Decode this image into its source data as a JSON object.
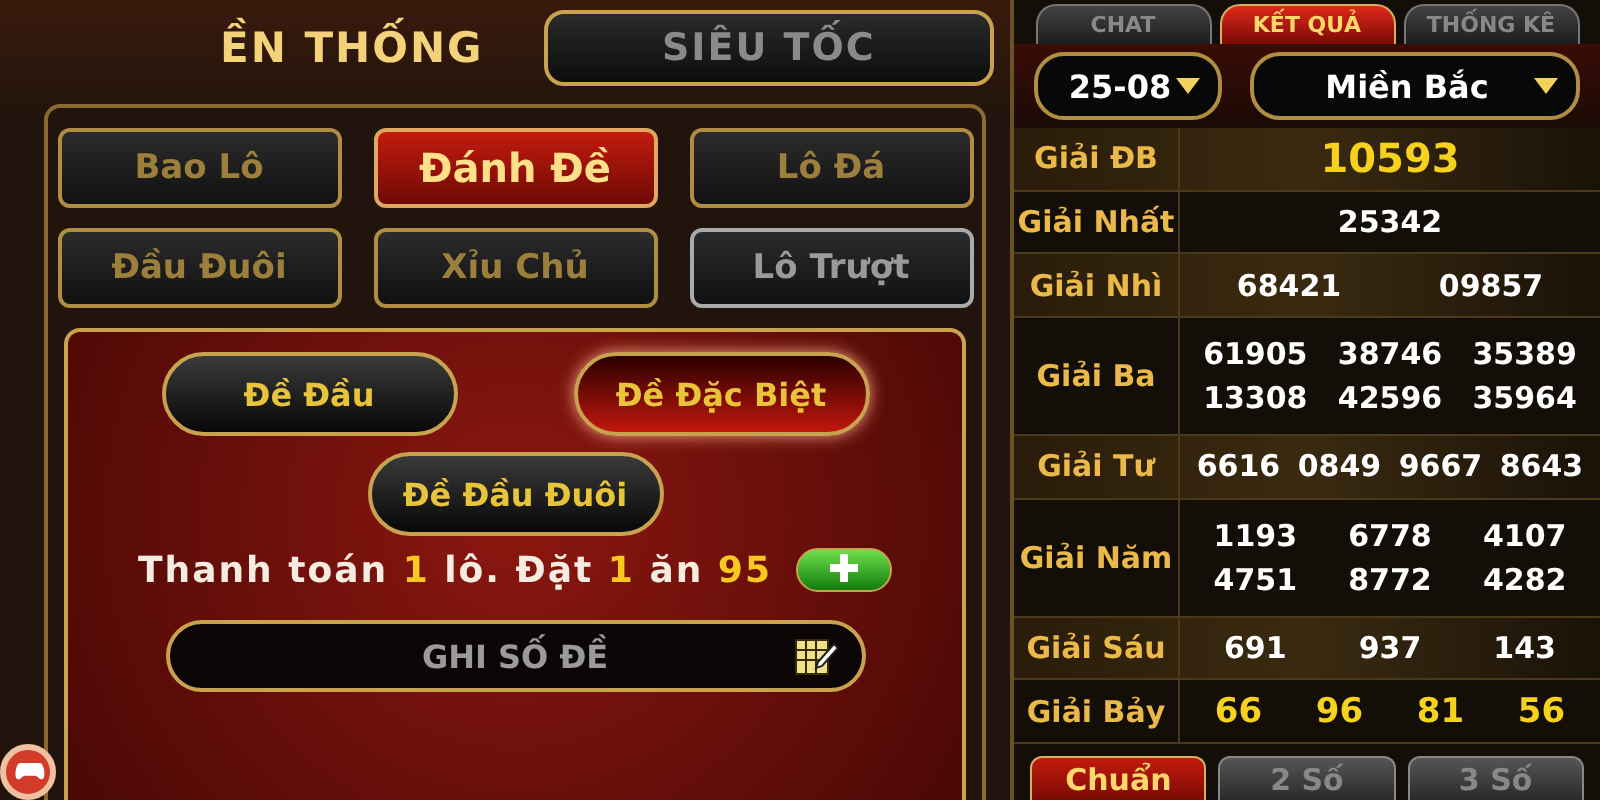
{
  "mode_tabs": [
    {
      "label": "ỀN THỐNG",
      "selected": true
    },
    {
      "label": "SIÊU TỐC",
      "selected": false
    }
  ],
  "bet_types": [
    {
      "label": "Bao Lô",
      "selected": false,
      "disabled": false
    },
    {
      "label": "Đánh Đề",
      "selected": true,
      "disabled": false
    },
    {
      "label": "Lô Đá",
      "selected": false,
      "disabled": false
    },
    {
      "label": "Đầu Đuôi",
      "selected": false,
      "disabled": false
    },
    {
      "label": "Xỉu Chủ",
      "selected": false,
      "disabled": false
    },
    {
      "label": "Lô Trượt",
      "selected": false,
      "disabled": true
    }
  ],
  "sub_types": [
    {
      "label": "Đề Đầu",
      "selected": false
    },
    {
      "label": "Đề Đặc Biệt",
      "selected": true
    },
    {
      "label": "Đề Đầu Đuôi",
      "selected": false
    }
  ],
  "payout": "Thanh toán **1** lô. Đặt **1** ăn **95**",
  "number_field": {
    "placeholder": "GHI SỐ ĐỀ"
  },
  "panel_tabs": [
    {
      "label": "CHAT",
      "selected": false
    },
    {
      "label": "KẾT QUẢ",
      "selected": true
    },
    {
      "label": "THỐNG KÊ",
      "selected": false
    }
  ],
  "date_select": {
    "value": "25-08"
  },
  "region_select": {
    "value": "Miền Bắc"
  },
  "results": [
    {
      "label": "Giải ĐB",
      "highlight": true,
      "numbers": [
        "10593"
      ]
    },
    {
      "label": "Giải Nhất",
      "highlight": false,
      "numbers": [
        "25342"
      ]
    },
    {
      "label": "Giải Nhì",
      "highlight": false,
      "numbers": [
        "68421",
        "09857"
      ]
    },
    {
      "label": "Giải Ba",
      "highlight": false,
      "numbers": [
        "61905",
        "38746",
        "35389",
        "13308",
        "42596",
        "35964"
      ]
    },
    {
      "label": "Giải Tư",
      "highlight": false,
      "numbers": [
        "6616",
        "0849",
        "9667",
        "8643"
      ]
    },
    {
      "label": "Giải Năm",
      "highlight": false,
      "numbers": [
        "1193",
        "6778",
        "4107",
        "4751",
        "8772",
        "4282"
      ]
    },
    {
      "label": "Giải Sáu",
      "highlight": false,
      "numbers": [
        "691",
        "937",
        "143"
      ]
    },
    {
      "label": "Giải Bảy",
      "highlight": true,
      "numbers": [
        "66",
        "96",
        "81",
        "56"
      ]
    }
  ],
  "result_tabs": [
    {
      "label": "Chuẩn",
      "selected": true
    },
    {
      "label": "2 Số",
      "selected": false
    },
    {
      "label": "3 Số",
      "selected": false
    }
  ]
}
